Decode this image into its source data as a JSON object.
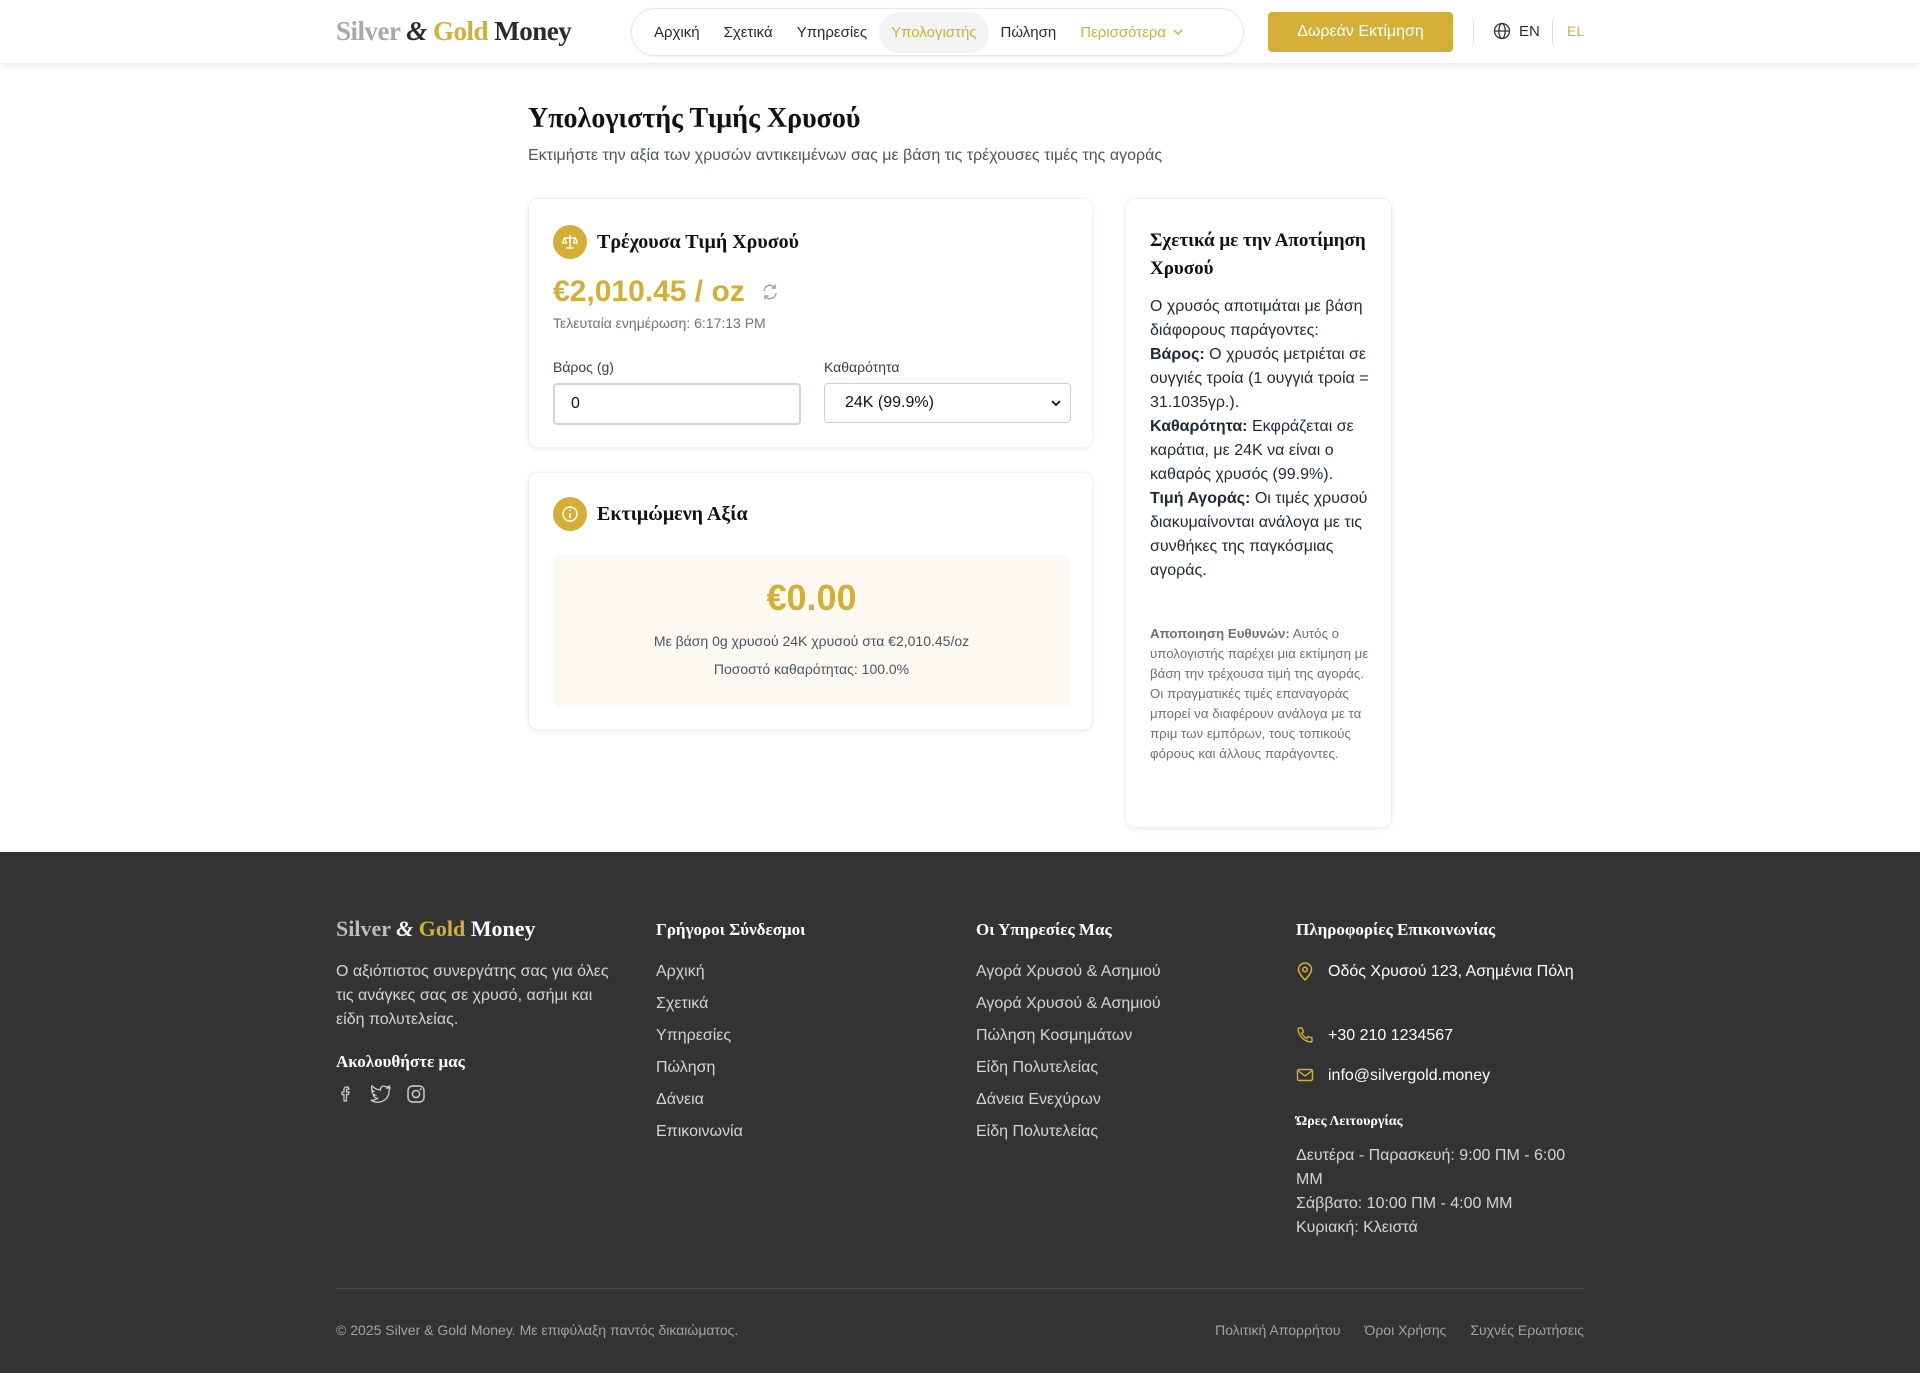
{
  "brand": {
    "silver": "Silver",
    "amp": "&",
    "gold": "Gold",
    "money": "Money"
  },
  "nav": {
    "items": [
      "Αρχική",
      "Σχετικά",
      "Υπηρεσίες",
      "Υπολογιστής",
      "Πώληση"
    ],
    "active": "Υπολογιστής",
    "more_label": "Περισσότερα"
  },
  "header": {
    "cta_label": "Δωρεάν Εκτίμηση",
    "lang_en": "EN",
    "lang_el": "EL"
  },
  "page": {
    "title": "Υπολογιστής Τιμής Χρυσού",
    "subtitle": "Εκτιμήστε την αξία των χρυσών αντικειμένων σας με βάση τις τρέχουσες τιμές της αγοράς"
  },
  "price_card": {
    "title": "Τρέχουσα Τιμή Χρυσού",
    "price": "€2,010.45 / oz",
    "updated": "Τελευταία ενημέρωση: 6:17:13 PM",
    "weight_label": "Βάρος (g)",
    "weight_value": "0",
    "purity_label": "Καθαρότητα",
    "purity_value": "24K (99.9%)"
  },
  "estimate_card": {
    "title": "Εκτιμώμενη Αξία",
    "value": "€0.00",
    "basis": "Με βάση 0g χρυσού 24K χρυσού στα €2,010.45/oz",
    "purity_pct": "Ποσοστό καθαρότητας: 100.0%"
  },
  "side": {
    "title": "Σχετικά με την Αποτίμηση Χρυσού",
    "intro": "Ο χρυσός αποτιμάται με βάση διάφορους παράγοντες:",
    "weight_term": "Βάρος:",
    "weight_text": "Ο χρυσός μετριέται σε ουγγιές τροία (1 ουγγιά τροία = 31.1035γρ.).",
    "purity_term": "Καθαρότητα:",
    "purity_text": "Εκφράζεται σε καράτια, με 24K να είναι ο καθαρός χρυσός (99.9%).",
    "market_term": "Τιμή Αγοράς:",
    "market_text": "Οι τιμές χρυσού διακυμαίνονται ανάλογα με τις συνθήκες της παγκόσμιας αγοράς.",
    "disclaimer_term": "Αποποιηση Ευθυνών:",
    "disclaimer_text": "Αυτός ο υπολογιστής παρέχει μια εκτίμηση με βάση την τρέχουσα τιμή της αγοράς. Οι πραγματικές τιμές επαναγοράς μπορεί να διαφέρουν ανάλογα με τα πριμ των εμπόρων, τους τοπικούς φόρους και άλλους παράγοντες."
  },
  "footer": {
    "description": "Ο αξιόπιστος συνεργάτης σας για όλες τις ανάγκες σας σε χρυσό, ασήμι και είδη πολυτελείας.",
    "follow": "Ακολουθήστε μας",
    "quick_links_title": "Γρήγοροι Σύνδεσμοι",
    "quick_links": [
      "Αρχική",
      "Σχετικά",
      "Υπηρεσίες",
      "Πώληση",
      "Δάνεια",
      "Επικοινωνία"
    ],
    "services_title": "Οι Υπηρεσίες Μας",
    "services": [
      "Αγορά Χρυσού & Ασημιού",
      "Αγορά Χρυσού & Ασημιού",
      "Πώληση Κοσμημάτων",
      "Είδη Πολυτελείας",
      "Δάνεια Ενεχύρων",
      "Είδη Πολυτελείας"
    ],
    "contact_title": "Πληροφορίες Επικοινωνίας",
    "address": "Οδός Χρυσού 123, Ασημένια Πόλη",
    "phone": "+30 210 1234567",
    "email": "info@silvergold.money",
    "hours_title": "Ώρες Λειτουργίας",
    "hours_weekdays": "Δευτέρα - Παρασκευή: 9:00 ΠΜ - 6:00 ΜΜ",
    "hours_saturday": "Σάββατο: 10:00 ΠΜ - 4:00 ΜΜ",
    "hours_sunday": "Κυριακή: Κλειστά",
    "copyright": "© 2025 Silver & Gold Money. Με επιφύλαξη παντός δικαιώματος.",
    "bottom_links": [
      "Πολιτική Απορρήτου",
      "Όροι Χρήσης",
      "Συχνές Ερωτήσεις"
    ]
  },
  "colors": {
    "accent": "#d4af37",
    "footer_bg": "#333333"
  }
}
